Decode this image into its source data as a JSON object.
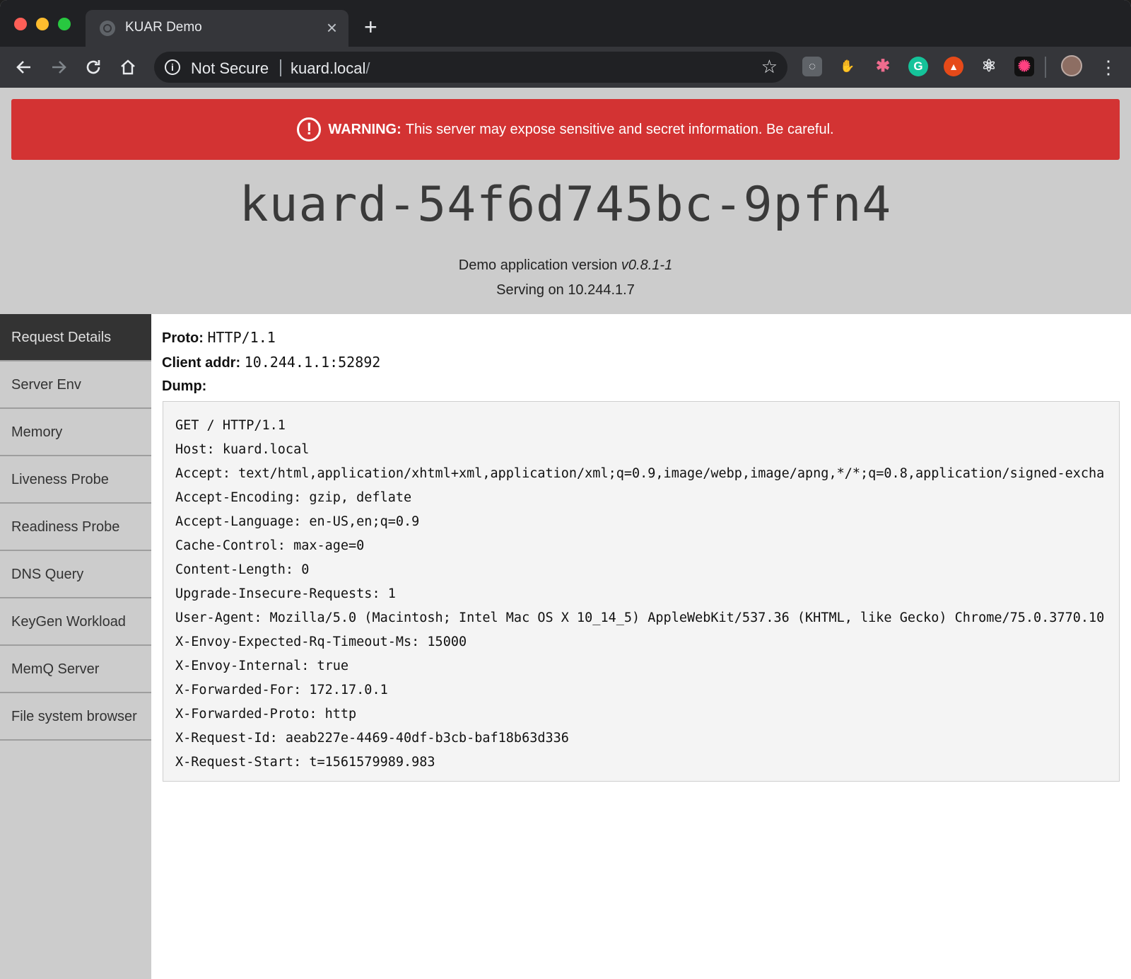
{
  "browser": {
    "tab_title": "KUAR Demo",
    "tab_close": "×",
    "new_tab": "+",
    "security_label": "Not Secure",
    "url_host": "kuard.local",
    "url_path": "/",
    "extensions": [
      {
        "name": "lightbulb-ext-icon",
        "glyph": "💡"
      },
      {
        "name": "paw-ext-icon",
        "glyph": "🐾"
      },
      {
        "name": "asterisk-ext-icon",
        "glyph": "✱"
      },
      {
        "name": "grammarly-ext-icon",
        "glyph": "G"
      },
      {
        "name": "orange-ext-icon",
        "glyph": "▲"
      },
      {
        "name": "react-ext-icon",
        "glyph": "⚛"
      },
      {
        "name": "color-ext-icon",
        "glyph": "✺"
      }
    ]
  },
  "warning": {
    "strong": "WARNING:",
    "text": "This server may expose sensitive and secret information. Be careful."
  },
  "header": {
    "hostname": "kuard-54f6d745bc-9pfn4",
    "version_prefix": "Demo application version",
    "version": "v0.8.1-1",
    "serving": "Serving on 10.244.1.7"
  },
  "sidebar": {
    "items": [
      {
        "label": "Request Details",
        "active": true
      },
      {
        "label": "Server Env"
      },
      {
        "label": "Memory"
      },
      {
        "label": "Liveness Probe"
      },
      {
        "label": "Readiness Probe"
      },
      {
        "label": "DNS Query"
      },
      {
        "label": "KeyGen Workload"
      },
      {
        "label": "MemQ Server"
      },
      {
        "label": "File system browser"
      }
    ]
  },
  "request": {
    "proto_label": "Proto:",
    "proto": "HTTP/1.1",
    "client_label": "Client addr:",
    "client": "10.244.1.1:52892",
    "dump_label": "Dump:",
    "dump_lines": [
      "GET / HTTP/1.1",
      "Host: kuard.local",
      "Accept: text/html,application/xhtml+xml,application/xml;q=0.9,image/webp,image/apng,*/*;q=0.8,application/signed-excha",
      "Accept-Encoding: gzip, deflate",
      "Accept-Language: en-US,en;q=0.9",
      "Cache-Control: max-age=0",
      "Content-Length: 0",
      "Upgrade-Insecure-Requests: 1",
      "User-Agent: Mozilla/5.0 (Macintosh; Intel Mac OS X 10_14_5) AppleWebKit/537.36 (KHTML, like Gecko) Chrome/75.0.3770.10",
      "X-Envoy-Expected-Rq-Timeout-Ms: 15000",
      "X-Envoy-Internal: true",
      "X-Forwarded-For: 172.17.0.1",
      "X-Forwarded-Proto: http",
      "X-Request-Id: aeab227e-4469-40df-b3cb-baf18b63d336",
      "X-Request-Start: t=1561579989.983"
    ]
  },
  "colors": {
    "warning_bg": "#d33333",
    "sidebar_active_bg": "#333333",
    "page_bg": "#cccccc"
  }
}
